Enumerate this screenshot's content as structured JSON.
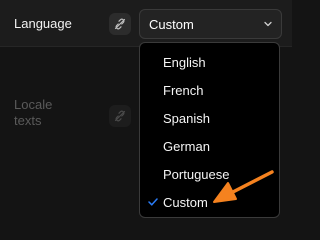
{
  "language_row": {
    "label": "Language",
    "link_icon": "link-off-icon",
    "select": {
      "value": "Custom",
      "chevron_icon": "chevron-down-icon"
    }
  },
  "locale_row": {
    "label": "Locale texts",
    "link_icon": "link-off-icon"
  },
  "dropdown": {
    "options": [
      "English",
      "French",
      "Spanish",
      "German",
      "Portuguese",
      "Custom"
    ],
    "selected_index": 5,
    "check_icon": "check-icon"
  },
  "colors": {
    "check": "#2a7cf7",
    "annotation_arrow": "#f5821f"
  },
  "annotation": "arrow-icon"
}
